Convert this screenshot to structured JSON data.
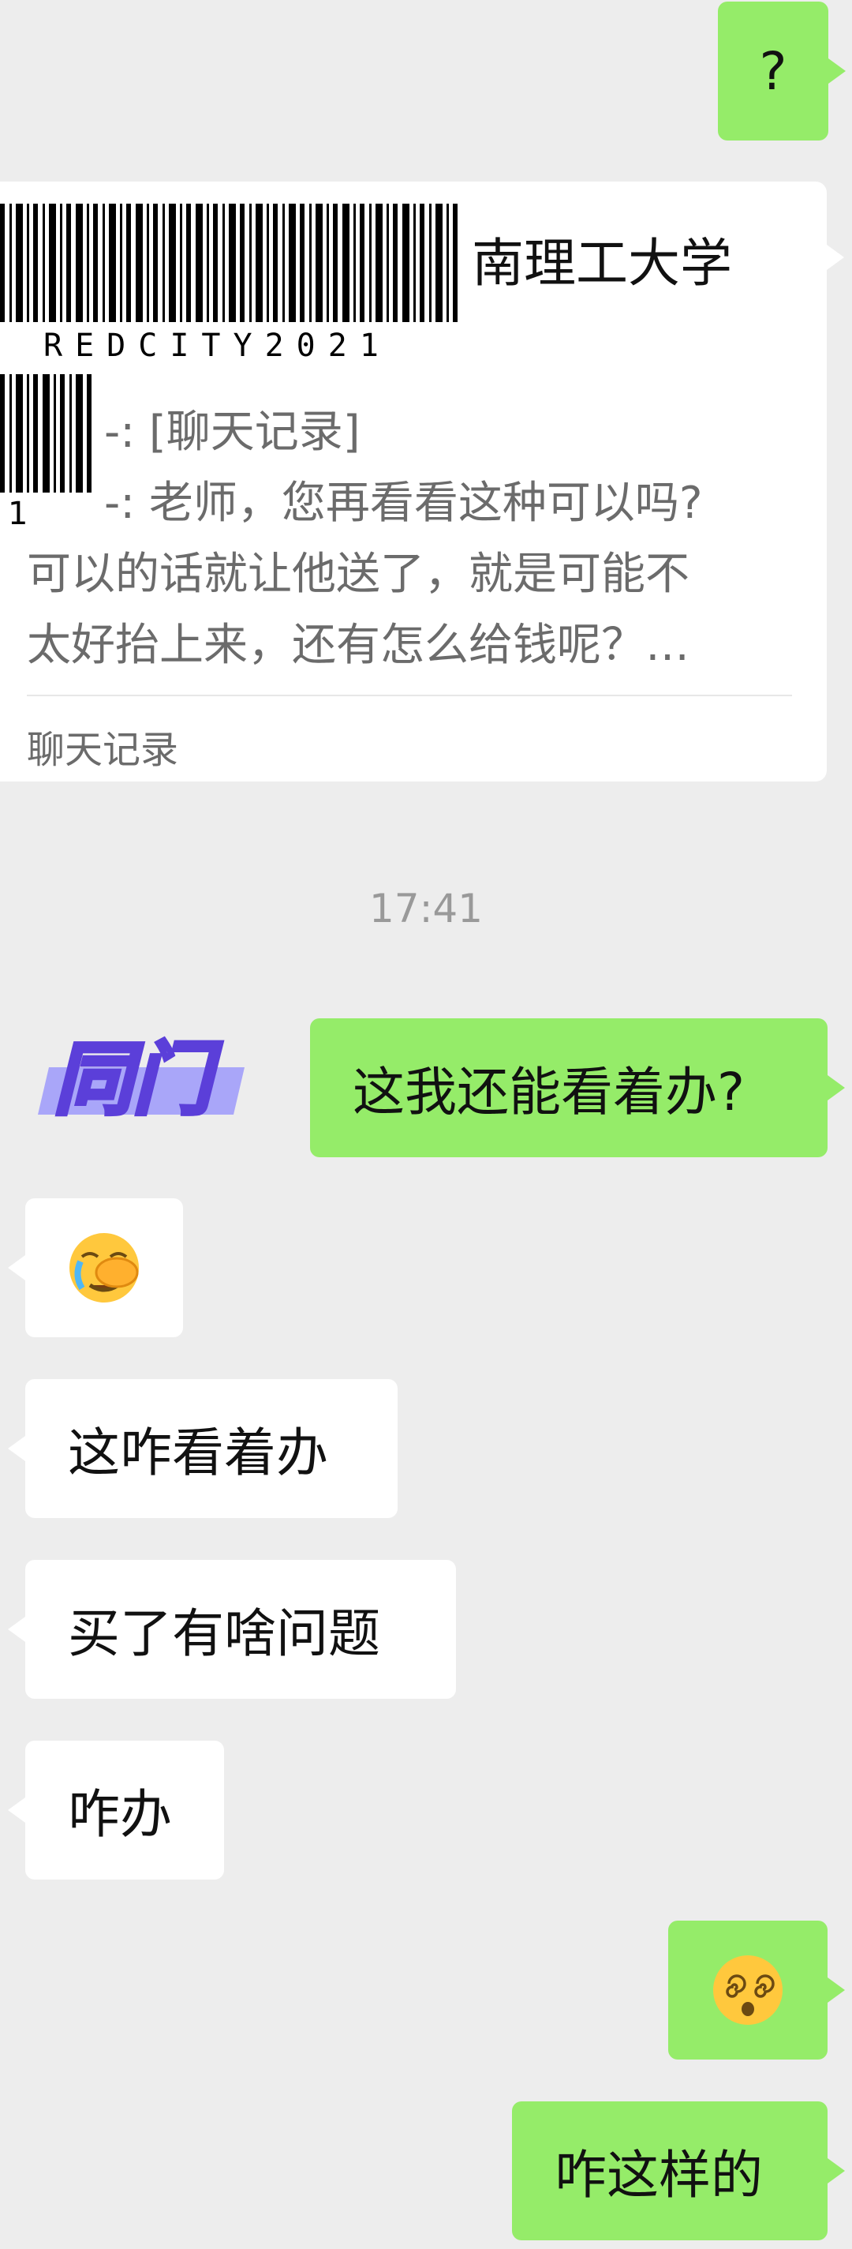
{
  "messages": {
    "question": "?",
    "reply_can_i": "这我还能看着办?",
    "zha_kanzhe": "这咋看着办",
    "mai_le": "买了有啥问题",
    "zha_ban": "咋办",
    "zha_zheyang": "咋这样的"
  },
  "forwarded_card": {
    "title_suffix": "南理工大学",
    "barcode_text": "REDCITY2021",
    "barcode_small_text": "1",
    "line1": "-: [聊天记录]",
    "line2": "-: 老师，您再看看这种可以吗?",
    "line3": "可以的话就让他送了，就是可能不",
    "line4": "太好抬上来，还有怎么给钱呢？…",
    "footer": "聊天记录"
  },
  "timestamp": "17:41",
  "sticker": {
    "text": "同门"
  },
  "emojis": {
    "facepalm": "facepalm-crying-emoji",
    "dizzy": "dizzy-face-emoji"
  },
  "colors": {
    "background": "#ededed",
    "outgoing_bubble": "#95ec69",
    "incoming_bubble": "#ffffff",
    "sticker_purple": "#7b6cf5"
  }
}
